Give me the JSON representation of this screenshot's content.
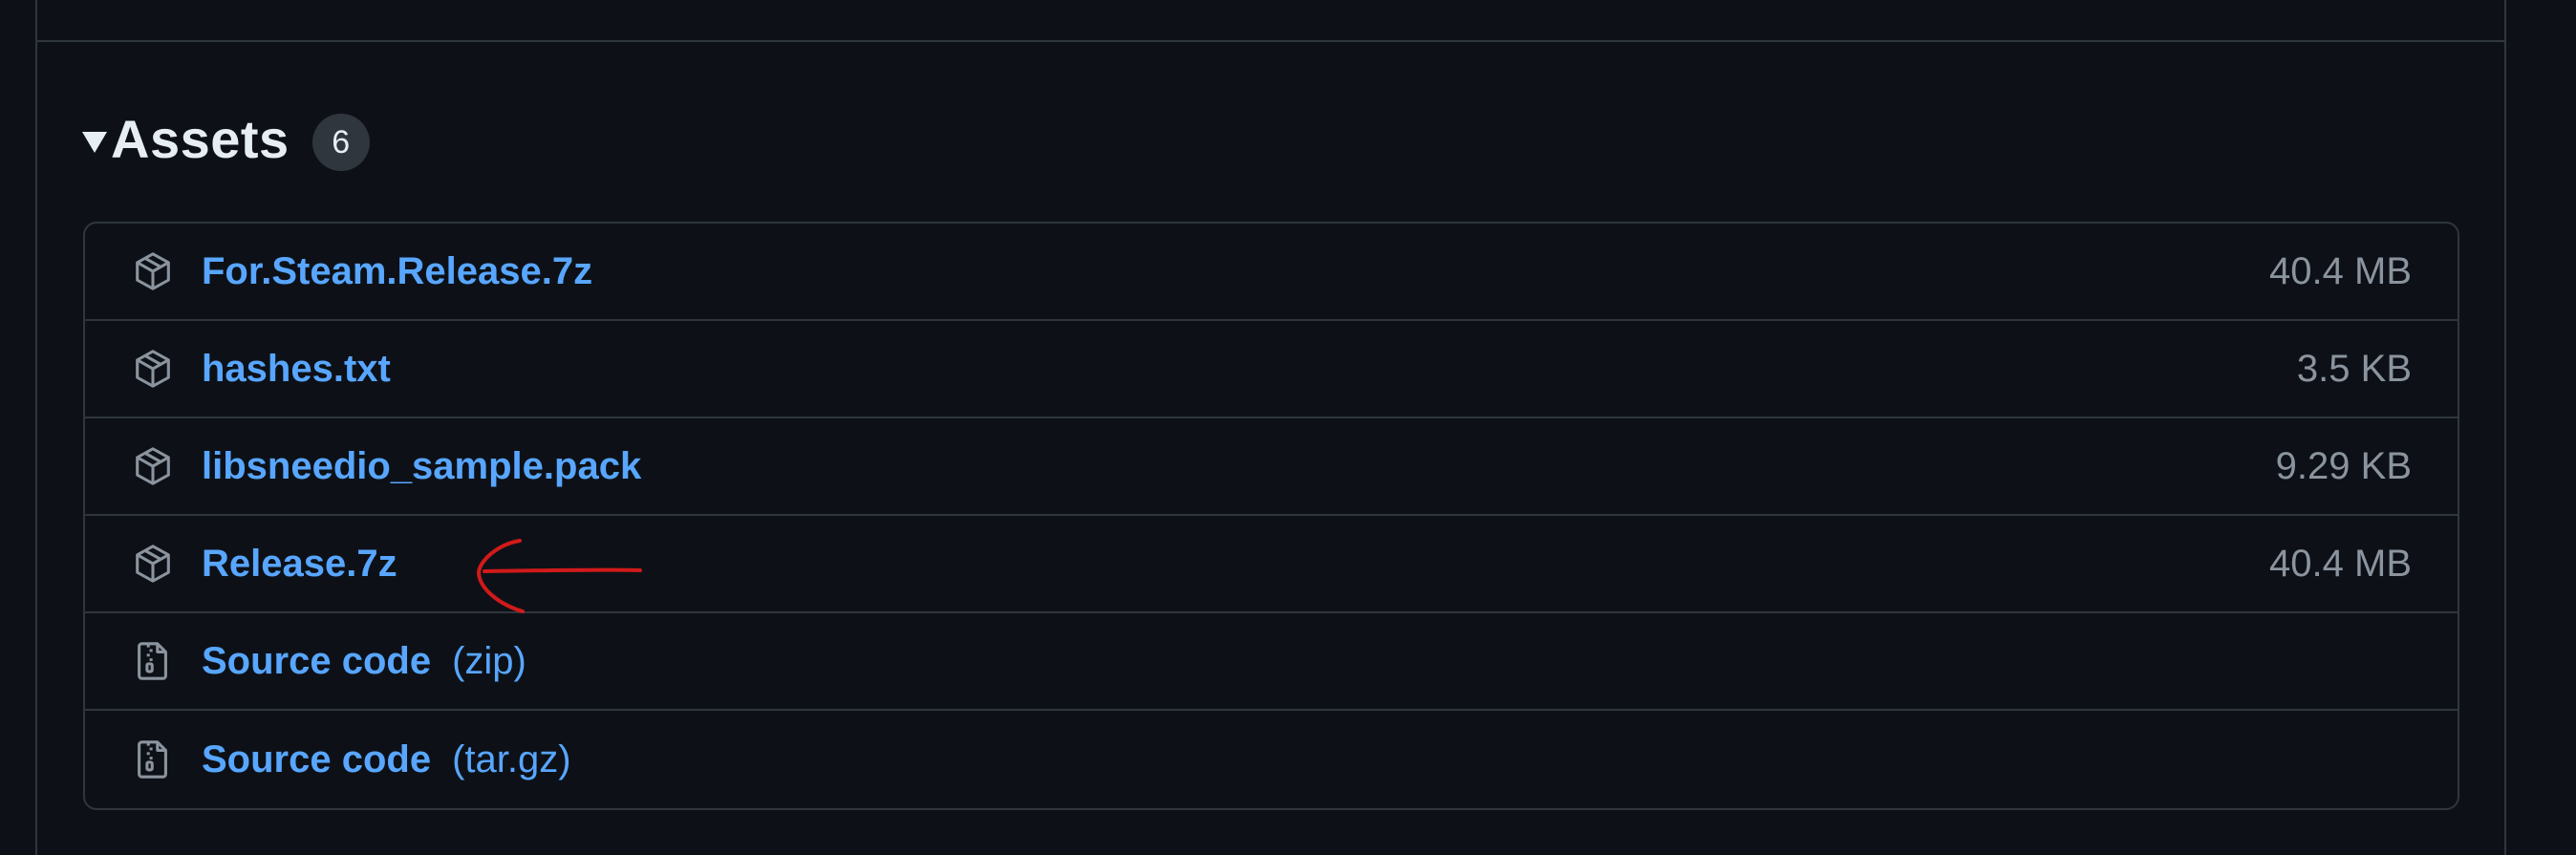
{
  "assets": {
    "title": "Assets",
    "count": "6",
    "items": [
      {
        "icon": "package-icon",
        "name": "For.Steam.Release.7z",
        "suffix": "",
        "size": "40.4 MB"
      },
      {
        "icon": "package-icon",
        "name": "hashes.txt",
        "suffix": "",
        "size": "3.5 KB"
      },
      {
        "icon": "package-icon",
        "name": "libsneedio_sample.pack",
        "suffix": "",
        "size": "9.29 KB"
      },
      {
        "icon": "package-icon",
        "name": "Release.7z",
        "suffix": "",
        "size": "40.4 MB"
      },
      {
        "icon": "file-zip-icon",
        "name": "Source code",
        "suffix": "(zip)",
        "size": ""
      },
      {
        "icon": "file-zip-icon",
        "name": "Source code",
        "suffix": "(tar.gz)",
        "size": ""
      }
    ]
  },
  "annotation": {
    "icon": "red-arrow-annotation",
    "color": "#d11a1a"
  },
  "colors": {
    "background": "#0d1117",
    "border": "#30363d",
    "link": "#58a6ff",
    "muted": "#8b949e",
    "text": "#e6edf3"
  }
}
